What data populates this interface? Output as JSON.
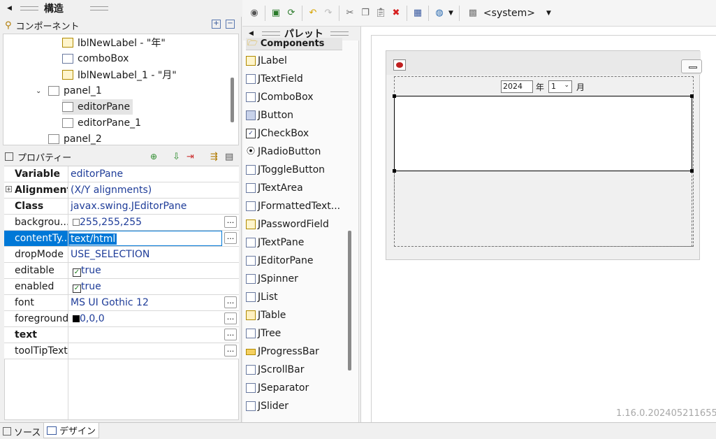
{
  "structure_view": {
    "title": "構造",
    "components": {
      "title": "コンポーネント",
      "tree": [
        {
          "label": "lblNewLabel - \"年\"",
          "icon": "label-icon"
        },
        {
          "label": "comboBox",
          "icon": "combobox-icon"
        },
        {
          "label": "lblNewLabel_1 - \"月\"",
          "icon": "label-icon"
        },
        {
          "label": "panel_1",
          "icon": "panel-icon"
        },
        {
          "label": "editorPane",
          "icon": "editor-pane-icon"
        },
        {
          "label": "editorPane_1",
          "icon": "editor-pane-icon"
        },
        {
          "label": "panel_2",
          "icon": "panel-icon"
        }
      ]
    },
    "properties": {
      "title": "プロパティー",
      "rows": [
        {
          "name": "Variable",
          "value": "editorPane"
        },
        {
          "name": "Alignment",
          "value": "(X/Y alignments)"
        },
        {
          "name": "Class",
          "value": "javax.swing.JEditorPane"
        },
        {
          "name": "backgrou...",
          "value": "255,255,255"
        },
        {
          "name": "contentTy...",
          "value": "text/html"
        },
        {
          "name": "dropMode",
          "value": "USE_SELECTION"
        },
        {
          "name": "editable",
          "value": "true"
        },
        {
          "name": "enabled",
          "value": "true"
        },
        {
          "name": "font",
          "value": "MS UI Gothic 12"
        },
        {
          "name": "foreground",
          "value": "0,0,0"
        },
        {
          "name": "text",
          "value": ""
        },
        {
          "name": "toolTipText",
          "value": ""
        }
      ],
      "ellipsis": "..."
    }
  },
  "toolbar": {
    "system_label": "<system>"
  },
  "palette": {
    "title": "パレット",
    "category": "Components",
    "items": [
      "JLabel",
      "JTextField",
      "JComboBox",
      "JButton",
      "JCheckBox",
      "JRadioButton",
      "JToggleButton",
      "JTextArea",
      "JFormattedText...",
      "JPasswordField",
      "JTextPane",
      "JEditorPane",
      "JSpinner",
      "JList",
      "JTable",
      "JTree",
      "JProgressBar",
      "JScrollBar",
      "JSeparator",
      "JSlider"
    ]
  },
  "design": {
    "year_value": "2024",
    "year_label": "年",
    "month_value": "1",
    "month_label": "月"
  },
  "version": "1.16.0.202405211655",
  "bottom_tabs": [
    "ソース",
    "デザイン"
  ],
  "colors": {
    "selection": "#0078d7",
    "link_blue": "#1f3d99"
  }
}
